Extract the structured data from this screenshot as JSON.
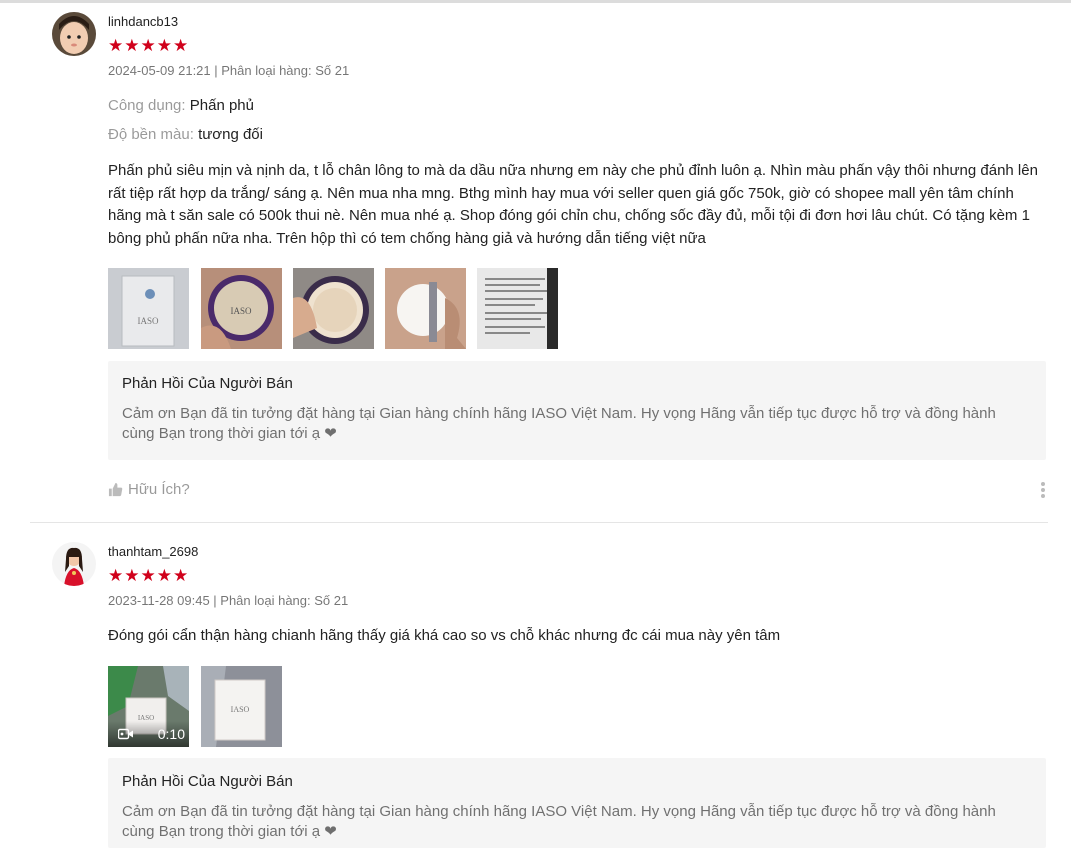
{
  "reviews": [
    {
      "username": "linhdancb13",
      "stars": "★★★★★",
      "meta": "2024-05-09 21:21 | Phân loại hàng: Số 21",
      "attributes": [
        {
          "key": "Công dụng:",
          "value": "Phấn phủ"
        },
        {
          "key": "Độ bền màu:",
          "value": "tương đối"
        }
      ],
      "text": "Phấn phủ siêu mịn và nịnh da, t lỗ chân lông to mà da dầu nữa nhưng em này che phủ đỉnh luôn ạ. Nhìn màu phấn vậy thôi nhưng đánh lên rất tiệp rất hợp da trắng/ sáng ạ. Nên mua nha mng. Bthg mình hay mua với seller quen giá gốc 750k, giờ có shopee mall yên tâm chính hãng mà t săn sale có 500k thui nè. Nên mua nhé ạ. Shop đóng gói chỉn chu, chống sốc đầy đủ, mỗi tội đi đơn hơi lâu chút. Có tặng kèm 1 bông phủ phấn nữa nha. Trên hộp thì có tem chống hàng giả và hướng dẫn tiếng việt nữa",
      "reply_title": "Phản Hồi Của Người Bán",
      "reply_text": "Cảm ơn Bạn đã tin tưởng đặt hàng tại Gian hàng chính hãng IASO Việt Nam. Hy vọng Hãng vẫn tiếp tục được hỗ trợ và đồng hành cùng Bạn trong thời gian tới ạ ❤",
      "helpful": "Hữu Ích?"
    },
    {
      "username": "thanhtam_2698",
      "stars": "★★★★★",
      "meta": "2023-11-28 09:45 | Phân loại hàng: Số 21",
      "text": "Đóng gói cẩn thận hàng chianh hãng thấy giá khá cao so vs chỗ khác nhưng đc cái mua này yên tâm",
      "video_duration": "0:10",
      "reply_title": "Phản Hồi Của Người Bán",
      "reply_text": "Cảm ơn Bạn đã tin tưởng đặt hàng tại Gian hàng chính hãng IASO Việt Nam. Hy vọng Hãng vẫn tiếp tục được hỗ trợ và đồng hành cùng Bạn trong thời gian tới ạ ❤"
    }
  ],
  "product_brand": "IASO",
  "colors": {
    "star": "#d0011b",
    "reply_bg": "#f5f5f5"
  }
}
